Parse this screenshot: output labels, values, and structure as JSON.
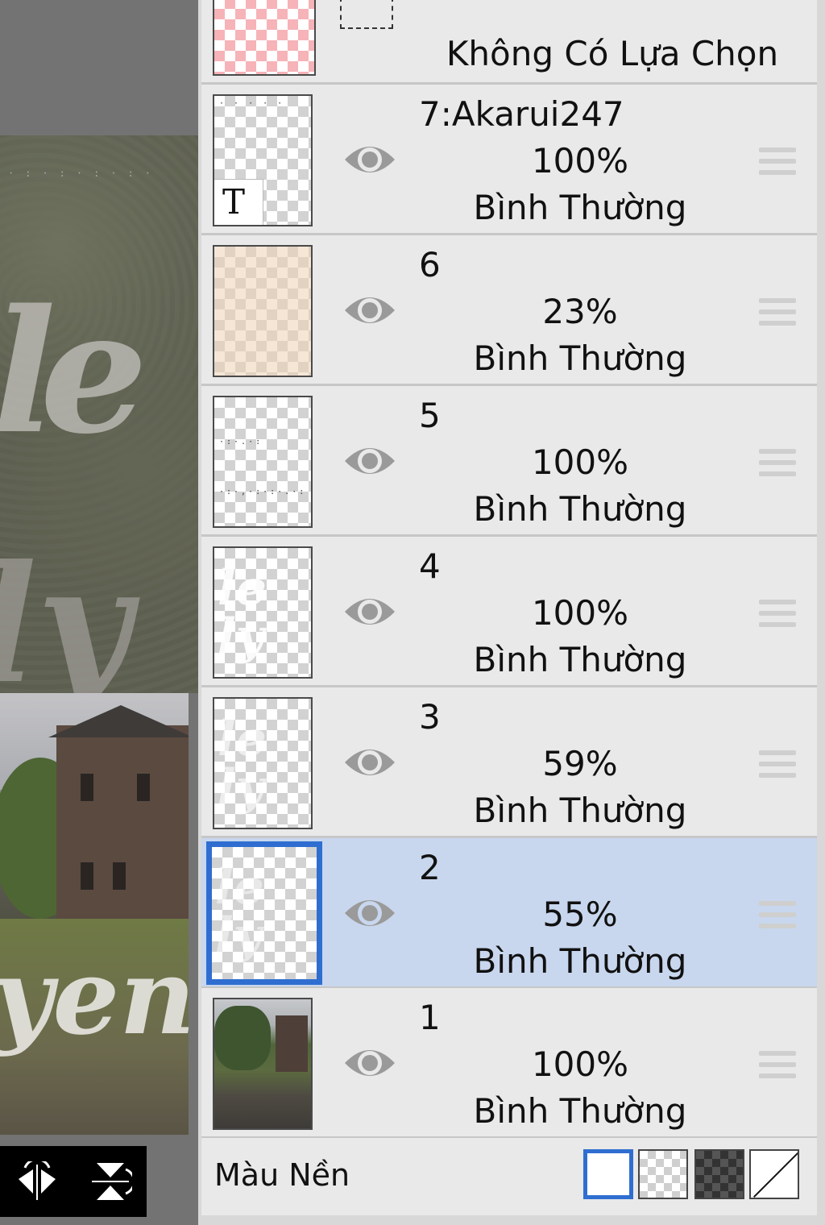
{
  "canvas": {
    "tools": [
      {
        "icon": "flip-horizontal-icon"
      },
      {
        "icon": "flip-vertical-icon"
      }
    ]
  },
  "layers_panel": {
    "selection_row": {
      "label": "Không Có Lựa Chọn",
      "thumb_color": "#f6b3b8"
    },
    "layers": [
      {
        "name": "7:Akarui247",
        "opacity": "100%",
        "blend": "Bình Thường",
        "selected": false
      },
      {
        "name": "6",
        "opacity": "23%",
        "blend": "Bình Thường",
        "selected": false
      },
      {
        "name": "5",
        "opacity": "100%",
        "blend": "Bình Thường",
        "selected": false
      },
      {
        "name": "4",
        "opacity": "100%",
        "blend": "Bình Thường",
        "selected": false
      },
      {
        "name": "3",
        "opacity": "59%",
        "blend": "Bình Thường",
        "selected": false
      },
      {
        "name": "2",
        "opacity": "55%",
        "blend": "Bình Thường",
        "selected": true
      },
      {
        "name": "1",
        "opacity": "100%",
        "blend": "Bình Thường",
        "selected": false
      }
    ],
    "background": {
      "label": "Màu Nền",
      "options": [
        "white",
        "transparent",
        "dark",
        "none"
      ],
      "selected": "white"
    },
    "colors": {
      "selected_row": "#c8d7ee",
      "selected_border": "#2f6ed0"
    }
  }
}
